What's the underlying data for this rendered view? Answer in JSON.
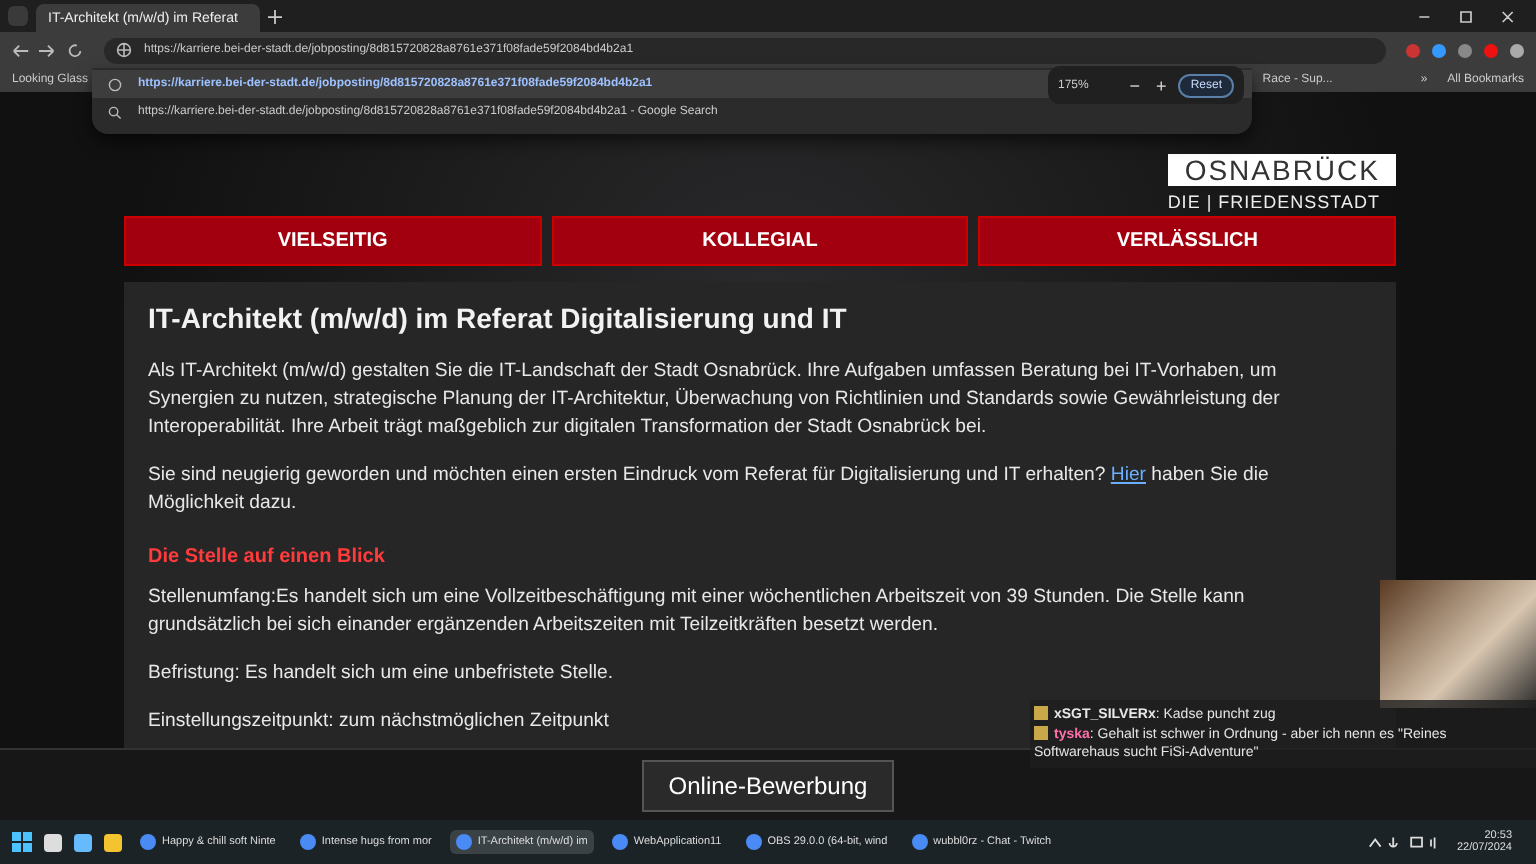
{
  "browser": {
    "tabs": [
      {
        "title": "IT-Architekt (m/w/d) im Referat",
        "selected": true
      }
    ],
    "address": "https://karriere.bei-der-stadt.de/jobposting/8d815720828a8761e371f08fade59f2084bd4b2a1",
    "suggestions": [
      {
        "kind": "url",
        "text": "https://karriere.bei-der-stadt.de/jobposting/8d815720828a8761e371f08fade59f2084bd4b2a1"
      },
      {
        "kind": "search",
        "text": "https://karriere.bei-der-stadt.de/jobposting/8d815720828a8761e371f08fade59f2084bd4b2a1 - Google Search"
      }
    ],
    "bookmarks": [
      "Looking Glass",
      "Race - Sup..."
    ],
    "bookmarks_more": "»",
    "all_bookmarks": "All Bookmarks",
    "zoom": {
      "value": "175%",
      "minus": "−",
      "plus": "+",
      "reset": "Reset"
    }
  },
  "page": {
    "logo": "OSNABRÜCK",
    "tagline": "DIE | FRIEDENSSTADT",
    "nav": [
      "VIELSEITIG",
      "KOLLEGIAL",
      "VERLÄSSLICH"
    ],
    "title": "IT-Architekt (m/w/d) im Referat Digitalisierung und IT",
    "intro": "Als IT-Architekt (m/w/d) gestalten Sie die IT-Landschaft der Stadt Osnabrück. Ihre Aufgaben umfassen Beratung bei IT-Vorhaben, um Synergien zu nutzen, strategische Planung der IT-Architektur, Überwachung von Richtlinien und Standards sowie Gewährleistung der Interoperabilität. Ihre Arbeit trägt maßgeblich zur digitalen Transformation der Stadt Osnabrück bei.",
    "curious": {
      "before": "Sie sind neugierig geworden und möchten einen ersten Eindruck vom Referat für Digitalisierung und IT erhalten?",
      "link": "Hier",
      "after": "haben Sie die Möglichkeit dazu."
    },
    "section_heading": "Die Stelle auf einen Blick",
    "facts": [
      "Stellenumfang:Es handelt sich um eine Vollzeitbeschäftigung mit einer wöchentlichen Arbeitszeit von 39 Stunden. Die Stelle kann grundsätzlich bei sich einander ergänzenden Arbeitszeiten mit Teilzeitkräften besetzt werden.",
      "Befristung: Es handelt sich um eine unbefristete Stelle.",
      "Einstellungszeitpunkt: zum nächstmöglichen Zeitpunkt"
    ],
    "apply_button": "Online-Bewerbung"
  },
  "chat": [
    {
      "user": "xSGT_SILVERx",
      "color": "#e8e8e8",
      "text": ": Kadse puncht zug"
    },
    {
      "user": "tyska",
      "color": "#ff6fa8",
      "text": ": Gehalt ist schwer in Ordnung - aber ich nenn es \"Reines Softwarehaus sucht FiSi-Adventure\""
    }
  ],
  "taskbar": {
    "apps": [
      {
        "label": "Happy & chill soft Ninte",
        "selected": false
      },
      {
        "label": "Intense hugs from mor",
        "selected": false
      },
      {
        "label": "IT-Architekt (m/w/d) im",
        "selected": true
      },
      {
        "label": "WebApplication11",
        "selected": false
      },
      {
        "label": "OBS 29.0.0 (64-bit, wind",
        "selected": false
      },
      {
        "label": "wubbl0rz - Chat - Twitch",
        "selected": false
      }
    ],
    "time": "20:53",
    "date": "22/07/2024"
  }
}
